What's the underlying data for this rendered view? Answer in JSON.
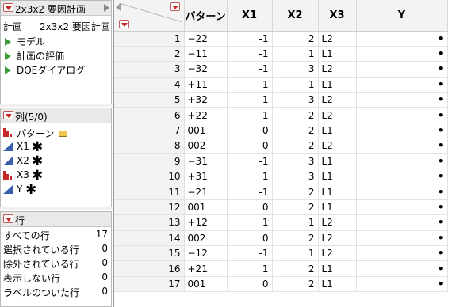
{
  "table_panel": {
    "title": "2x3x2 要因計画",
    "design_label": "計画",
    "design_value": "2x3x2 要因計画",
    "scripts": [
      "モデル",
      "計画の評価",
      "DOEダイアログ"
    ]
  },
  "columns_panel": {
    "title": "列(5/0)",
    "columns": [
      {
        "name": "パターン",
        "type": "nominal",
        "has_star": false,
        "has_label_icon": true
      },
      {
        "name": "X1",
        "type": "continuous",
        "has_star": true
      },
      {
        "name": "X2",
        "type": "continuous",
        "has_star": true
      },
      {
        "name": "X3",
        "type": "nominal",
        "has_star": true
      },
      {
        "name": "Y",
        "type": "continuous",
        "has_star": true
      }
    ]
  },
  "rows_panel": {
    "title": "行",
    "stats": [
      {
        "label": "すべての行",
        "value": "17"
      },
      {
        "label": "選択されている行",
        "value": "0"
      },
      {
        "label": "除外されている行",
        "value": "0"
      },
      {
        "label": "表示しない行",
        "value": "0"
      },
      {
        "label": "ラベルのついた行",
        "value": "0"
      }
    ]
  },
  "grid": {
    "headers": [
      "パターン",
      "X1",
      "X2",
      "X3",
      "Y"
    ],
    "rows": [
      [
        "1",
        "−22",
        "-1",
        "2",
        "L2",
        "•"
      ],
      [
        "2",
        "−11",
        "-1",
        "1",
        "L1",
        "•"
      ],
      [
        "3",
        "−32",
        "-1",
        "3",
        "L2",
        "•"
      ],
      [
        "4",
        "+11",
        "1",
        "1",
        "L1",
        "•"
      ],
      [
        "5",
        "+32",
        "1",
        "3",
        "L2",
        "•"
      ],
      [
        "6",
        "+22",
        "1",
        "2",
        "L2",
        "•"
      ],
      [
        "7",
        "001",
        "0",
        "2",
        "L1",
        "•"
      ],
      [
        "8",
        "002",
        "0",
        "2",
        "L2",
        "•"
      ],
      [
        "9",
        "−31",
        "-1",
        "3",
        "L1",
        "•"
      ],
      [
        "10",
        "+31",
        "1",
        "3",
        "L1",
        "•"
      ],
      [
        "11",
        "−21",
        "-1",
        "2",
        "L1",
        "•"
      ],
      [
        "12",
        "001",
        "0",
        "2",
        "L1",
        "•"
      ],
      [
        "13",
        "+12",
        "1",
        "1",
        "L2",
        "•"
      ],
      [
        "14",
        "002",
        "0",
        "2",
        "L2",
        "•"
      ],
      [
        "15",
        "−12",
        "-1",
        "1",
        "L2",
        "•"
      ],
      [
        "16",
        "+21",
        "1",
        "2",
        "L1",
        "•"
      ],
      [
        "17",
        "001",
        "0",
        "2",
        "L1",
        "•"
      ]
    ]
  }
}
